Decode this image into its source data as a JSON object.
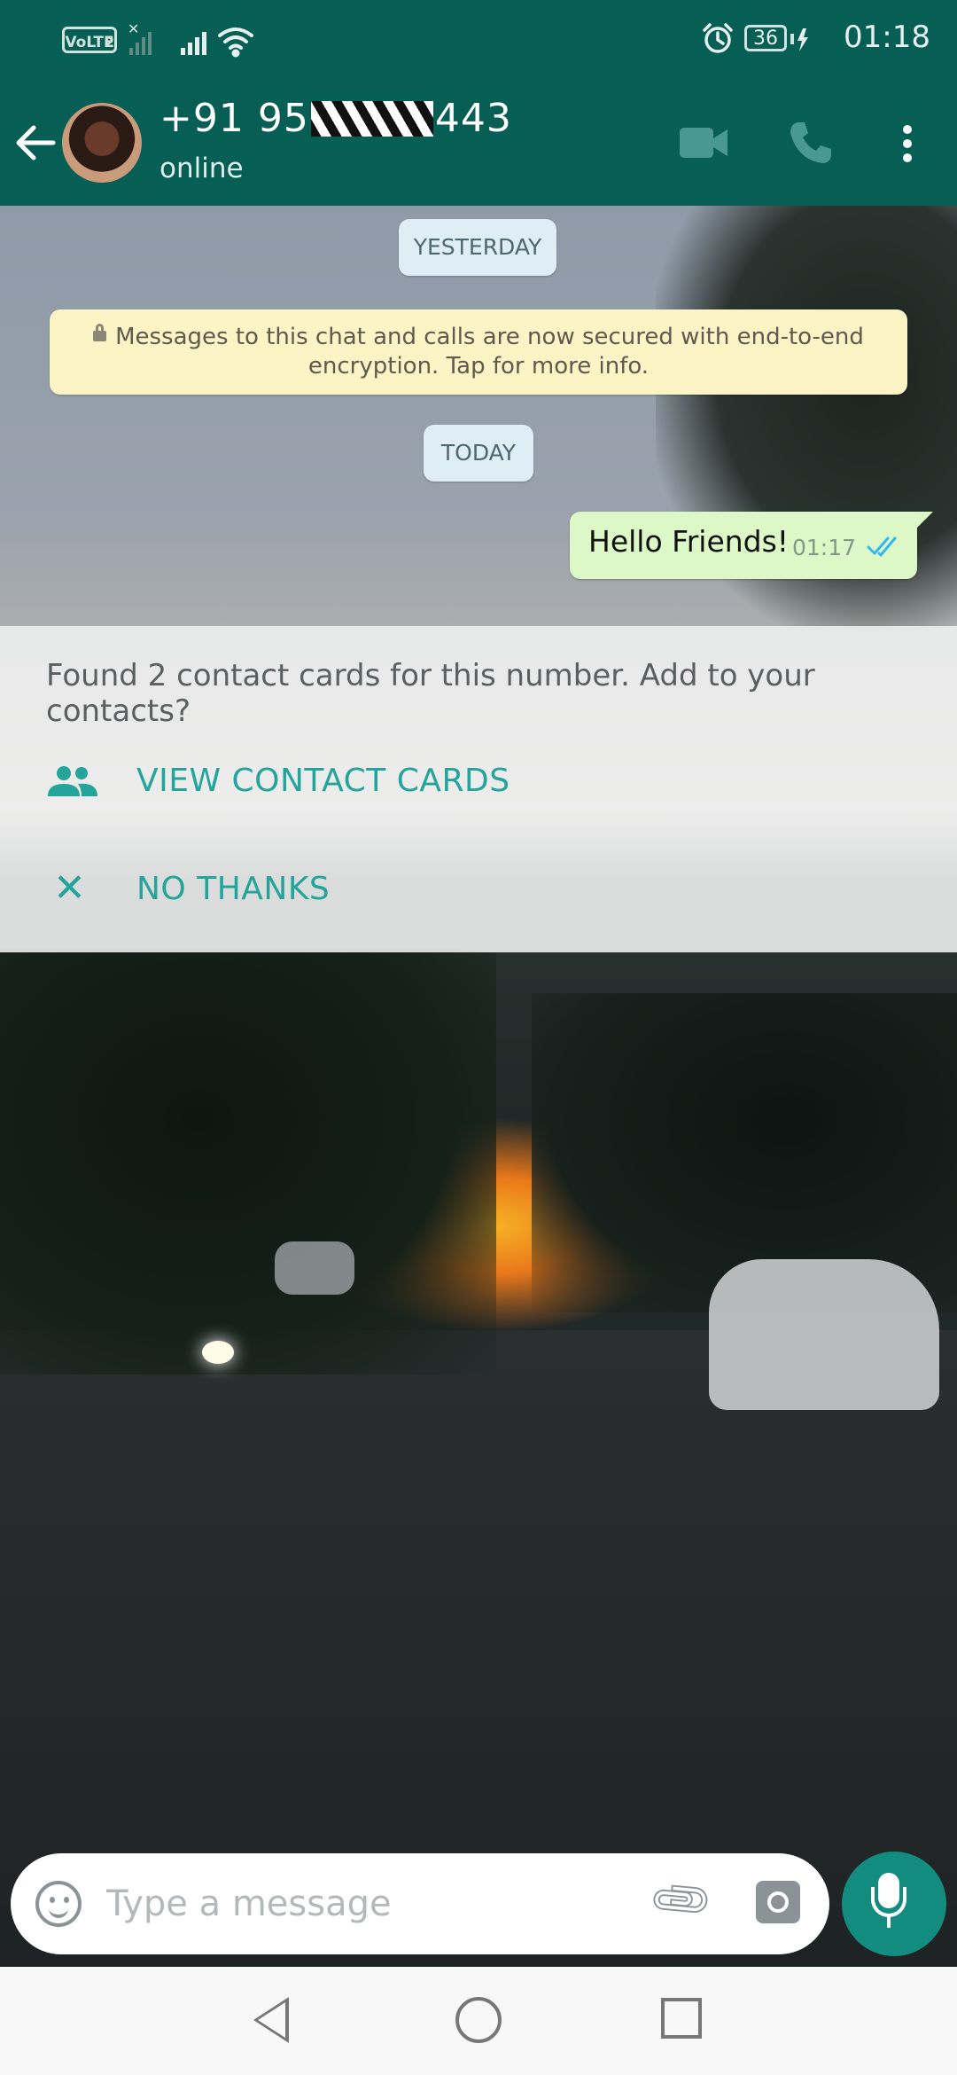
{
  "status_bar": {
    "volte": "VoLTE",
    "sim": "2",
    "battery": "36",
    "time": "01:18",
    "icons": [
      "signal-x-icon",
      "signal-icon",
      "wifi-icon",
      "alarm-icon",
      "battery-icon",
      "charging-icon"
    ]
  },
  "header": {
    "name_prefix": "+91 95",
    "name_suffix": "443",
    "status": "online",
    "icons": [
      "back-arrow-icon",
      "avatar",
      "video-call-icon",
      "phone-call-icon",
      "more-options-icon"
    ]
  },
  "chat": {
    "date_yesterday": "YESTERDAY",
    "encryption_line1": "Messages to this chat and calls are now secured with end-to-end",
    "encryption_line2": "encryption. Tap for more info.",
    "date_today": "TODAY",
    "messages": [
      {
        "text": "Hello Friends!",
        "time": "01:17",
        "status": "read"
      }
    ]
  },
  "banner": {
    "text": "Found 2 contact cards for this number. Add to your contacts?",
    "view_label": "VIEW CONTACT CARDS",
    "no_label": "NO THANKS"
  },
  "input": {
    "placeholder": "Type a message",
    "value": ""
  },
  "colors": {
    "header": "#075e54",
    "accent": "#24a49a",
    "mic_button": "#128c7e",
    "outgoing_bubble": "#dcf8c6",
    "read_ticks": "#34b7f1"
  }
}
